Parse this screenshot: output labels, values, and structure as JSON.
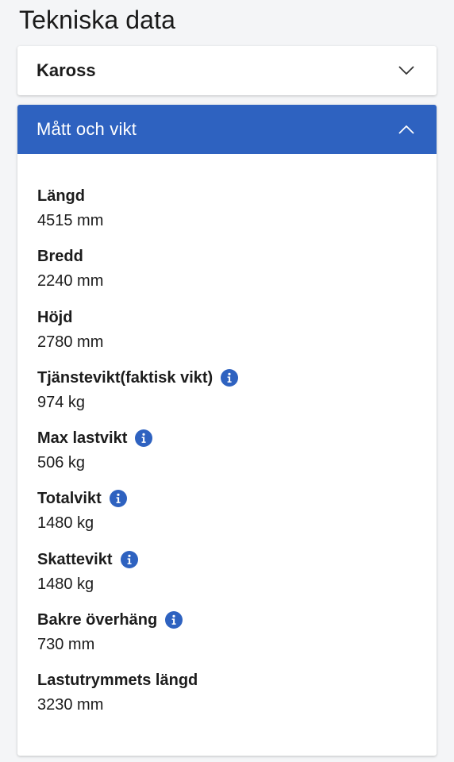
{
  "page": {
    "title": "Tekniska data"
  },
  "sections": {
    "kaross": {
      "label": "Kaross",
      "expanded": false,
      "icon": "chevron-down-icon"
    },
    "matt_och_vikt": {
      "label": "Mått och vikt",
      "expanded": true,
      "icon": "chevron-up-icon",
      "header_color": "#2e62c0"
    }
  },
  "specs": [
    {
      "label": "Längd",
      "value": "4515 mm",
      "info": false
    },
    {
      "label": "Bredd",
      "value": "2240 mm",
      "info": false
    },
    {
      "label": "Höjd",
      "value": "2780 mm",
      "info": false
    },
    {
      "label": "Tjänstevikt(faktisk vikt)",
      "value": "974 kg",
      "info": true
    },
    {
      "label": "Max lastvikt",
      "value": "506 kg",
      "info": true
    },
    {
      "label": "Totalvikt",
      "value": "1480 kg",
      "info": true
    },
    {
      "label": "Skattevikt",
      "value": "1480 kg",
      "info": true
    },
    {
      "label": "Bakre överhäng",
      "value": "730 mm",
      "info": true
    },
    {
      "label": "Lastutrymmets längd",
      "value": "3230 mm",
      "info": false
    }
  ],
  "colors": {
    "accent": "#2e62c0",
    "info_icon": "#2e62c0",
    "background": "#f4f5f7"
  }
}
